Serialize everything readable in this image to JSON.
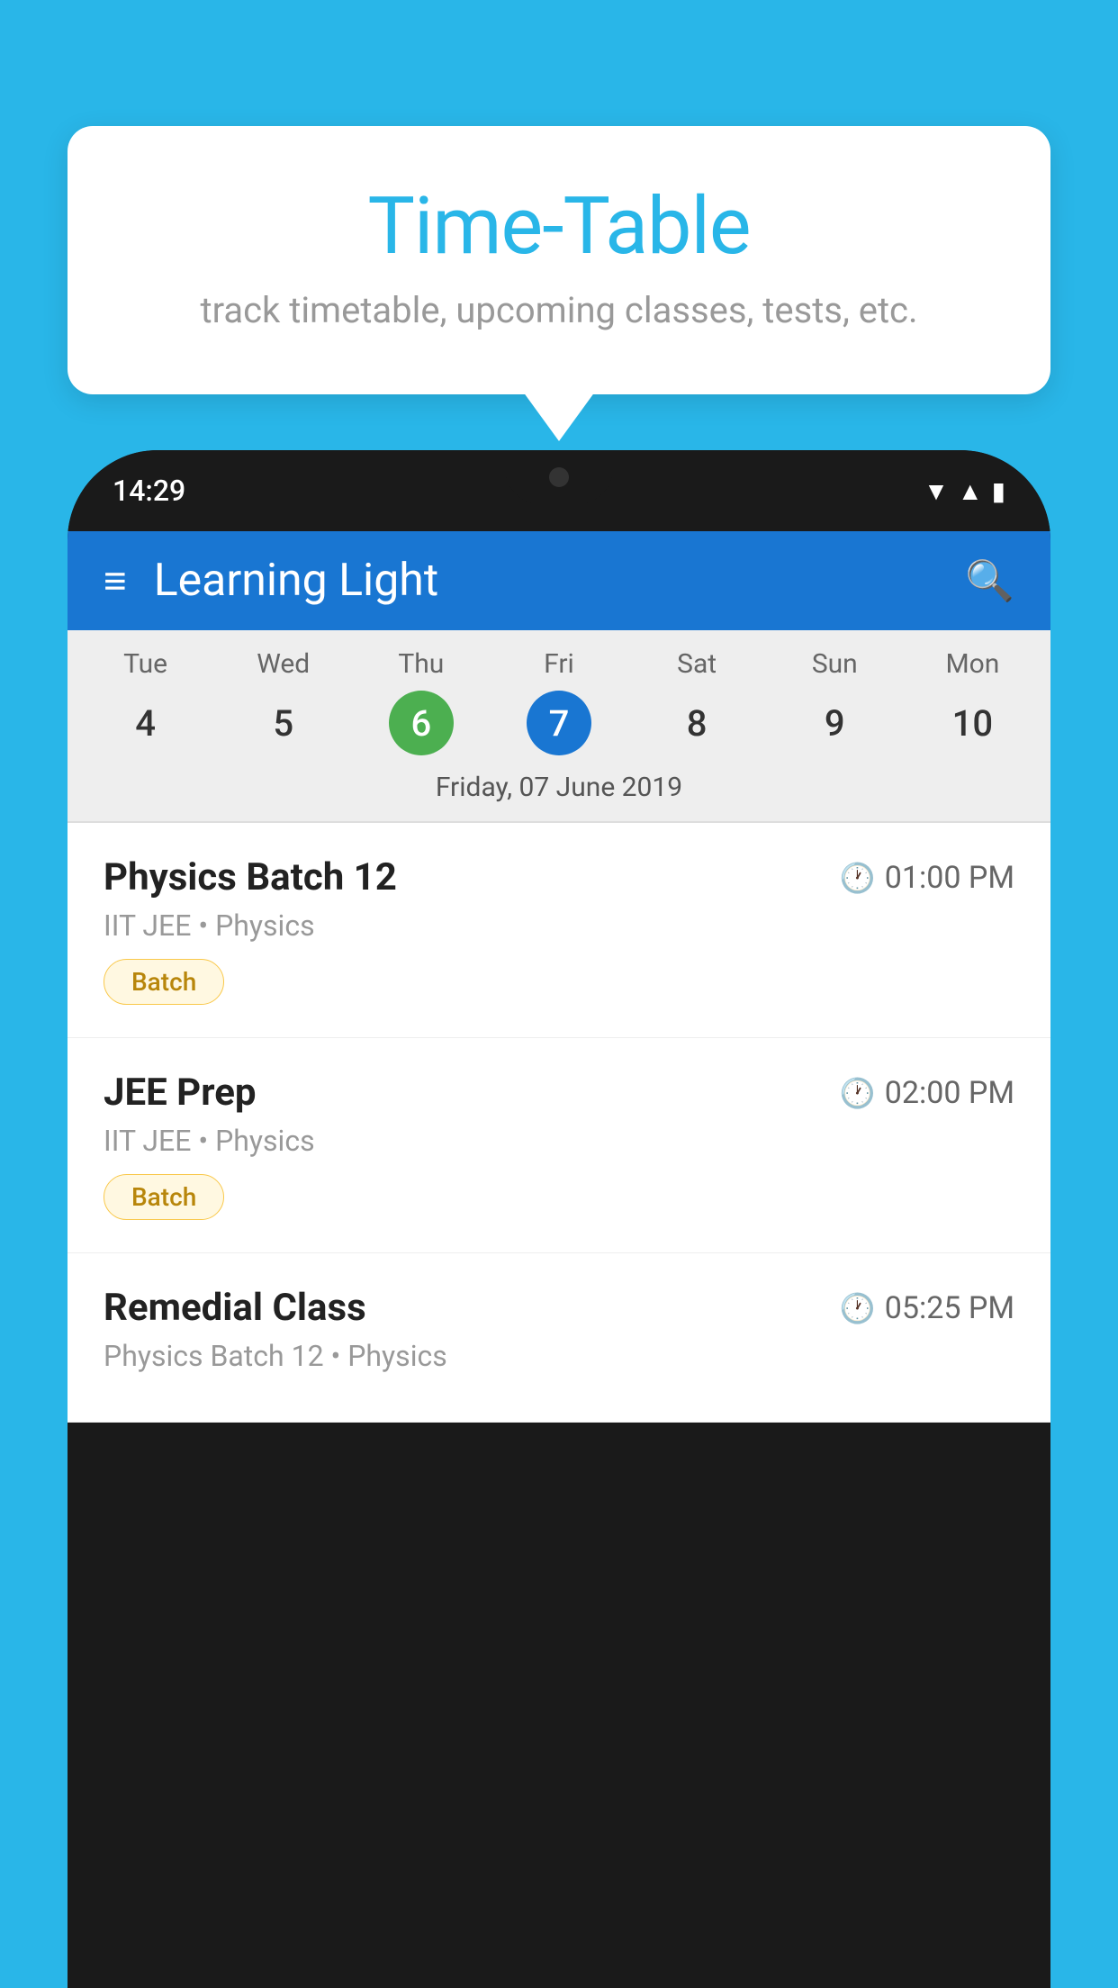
{
  "background_color": "#29b6e8",
  "tooltip": {
    "title": "Time-Table",
    "subtitle": "track timetable, upcoming classes, tests, etc."
  },
  "phone": {
    "status_bar": {
      "time": "14:29"
    },
    "header": {
      "app_name": "Learning Light",
      "hamburger_label": "≡",
      "search_label": "🔍"
    },
    "calendar": {
      "days": [
        {
          "name": "Tue",
          "number": "4",
          "state": "normal"
        },
        {
          "name": "Wed",
          "number": "5",
          "state": "normal"
        },
        {
          "name": "Thu",
          "number": "6",
          "state": "today"
        },
        {
          "name": "Fri",
          "number": "7",
          "state": "selected"
        },
        {
          "name": "Sat",
          "number": "8",
          "state": "normal"
        },
        {
          "name": "Sun",
          "number": "9",
          "state": "normal"
        },
        {
          "name": "Mon",
          "number": "10",
          "state": "normal"
        }
      ],
      "selected_date_label": "Friday, 07 June 2019"
    },
    "classes": [
      {
        "name": "Physics Batch 12",
        "time": "01:00 PM",
        "meta": "IIT JEE • Physics",
        "tag": "Batch"
      },
      {
        "name": "JEE Prep",
        "time": "02:00 PM",
        "meta": "IIT JEE • Physics",
        "tag": "Batch"
      },
      {
        "name": "Remedial Class",
        "time": "05:25 PM",
        "meta": "Physics Batch 12 • Physics",
        "tag": ""
      }
    ]
  }
}
